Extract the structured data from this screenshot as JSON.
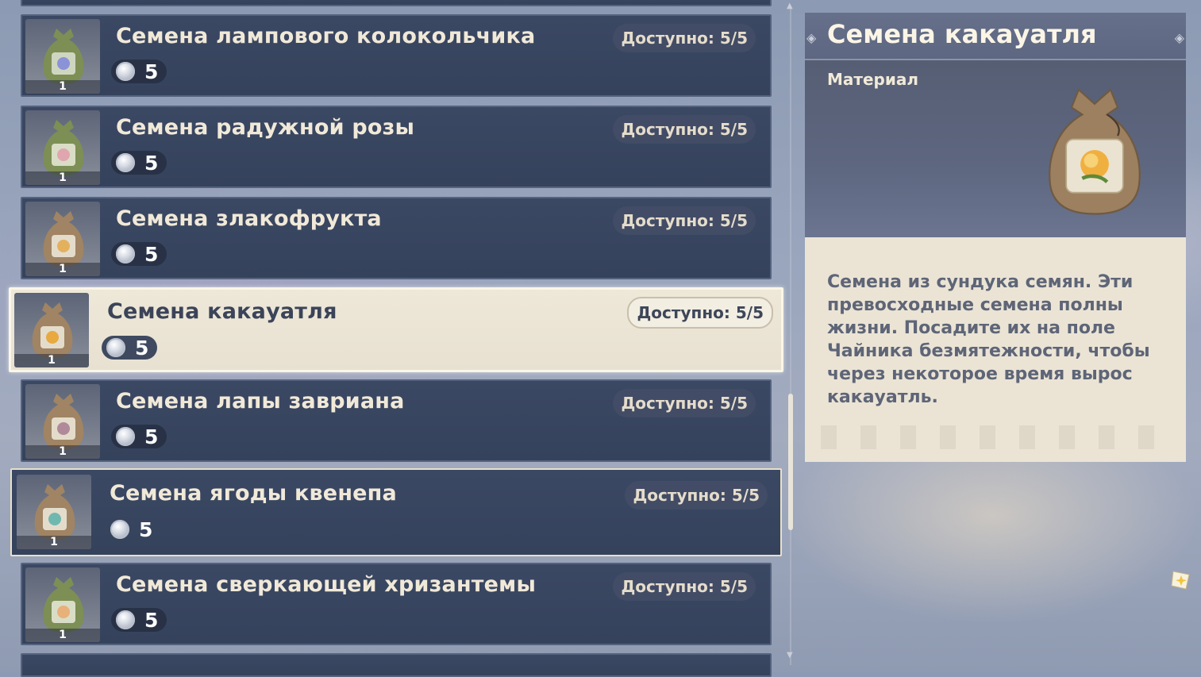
{
  "list": {
    "items": [
      {
        "title": "Семена лампового колокольчика",
        "avail": "Доступно: 5/5",
        "cost": "5",
        "qty": "1",
        "bag": "green"
      },
      {
        "title": "Семена радужной розы",
        "avail": "Доступно: 5/5",
        "cost": "5",
        "qty": "1",
        "bag": "green"
      },
      {
        "title": "Семена злакофрукта",
        "avail": "Доступно: 5/5",
        "cost": "5",
        "qty": "1",
        "bag": "brown"
      },
      {
        "title": "Семена какауатля",
        "avail": "Доступно: 5/5",
        "cost": "5",
        "qty": "1",
        "bag": "brown"
      },
      {
        "title": "Семена лапы завриана",
        "avail": "Доступно: 5/5",
        "cost": "5",
        "qty": "1",
        "bag": "brown"
      },
      {
        "title": "Семена ягоды квенепа",
        "avail": "Доступно: 5/5",
        "cost": "5",
        "qty": "1",
        "bag": "brown"
      },
      {
        "title": "Семена сверкающей хризантемы",
        "avail": "Доступно: 5/5",
        "cost": "5",
        "qty": "1",
        "bag": "green"
      }
    ]
  },
  "detail": {
    "name": "Семена какауатля",
    "category": "Материал",
    "description": "Семена из сундука семян. Эти превосходные семена полны жизни. Посадите их на поле Чайника безмятежности, чтобы через некоторое время вырос какауатль."
  },
  "colors": {
    "panel": "#3b4863",
    "selected": "#eee8d9",
    "title_text": "#f1e9d8",
    "desc_bg": "#ebe4d5"
  },
  "icons": {
    "currency": "mora-coin-icon",
    "seed": "seed-bag-icon",
    "corner": "paimon-star-icon"
  }
}
